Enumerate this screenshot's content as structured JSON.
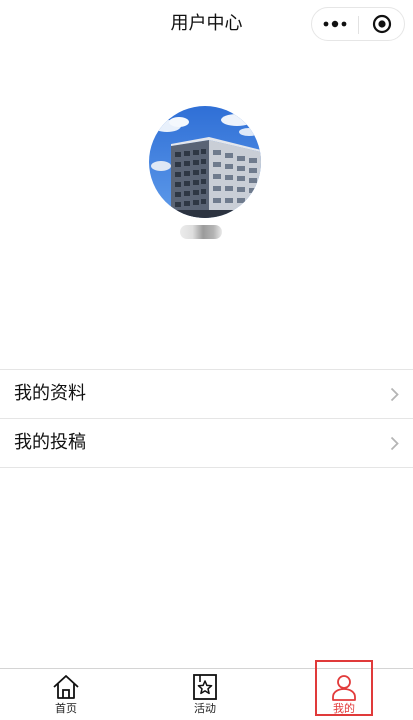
{
  "navbar": {
    "title": "用户中心",
    "more_icon": "more-dots-icon",
    "close_icon": "target-close-icon"
  },
  "profile": {
    "avatar_alt": "building-photo",
    "nickname": "用户"
  },
  "menu": {
    "items": [
      {
        "label": "我的资料",
        "icon": "chevron-right-icon"
      },
      {
        "label": "我的投稿",
        "icon": "chevron-right-icon"
      }
    ]
  },
  "tabbar": {
    "active_color": "#e23b3b",
    "tabs": [
      {
        "label": "首页",
        "icon": "home-icon",
        "active": false
      },
      {
        "label": "活动",
        "icon": "star-bookmark-icon",
        "active": false
      },
      {
        "label": "我的",
        "icon": "user-icon",
        "active": true
      }
    ]
  },
  "colors": {
    "highlight": "#e03a3a",
    "divider": "#e5e5e5"
  }
}
